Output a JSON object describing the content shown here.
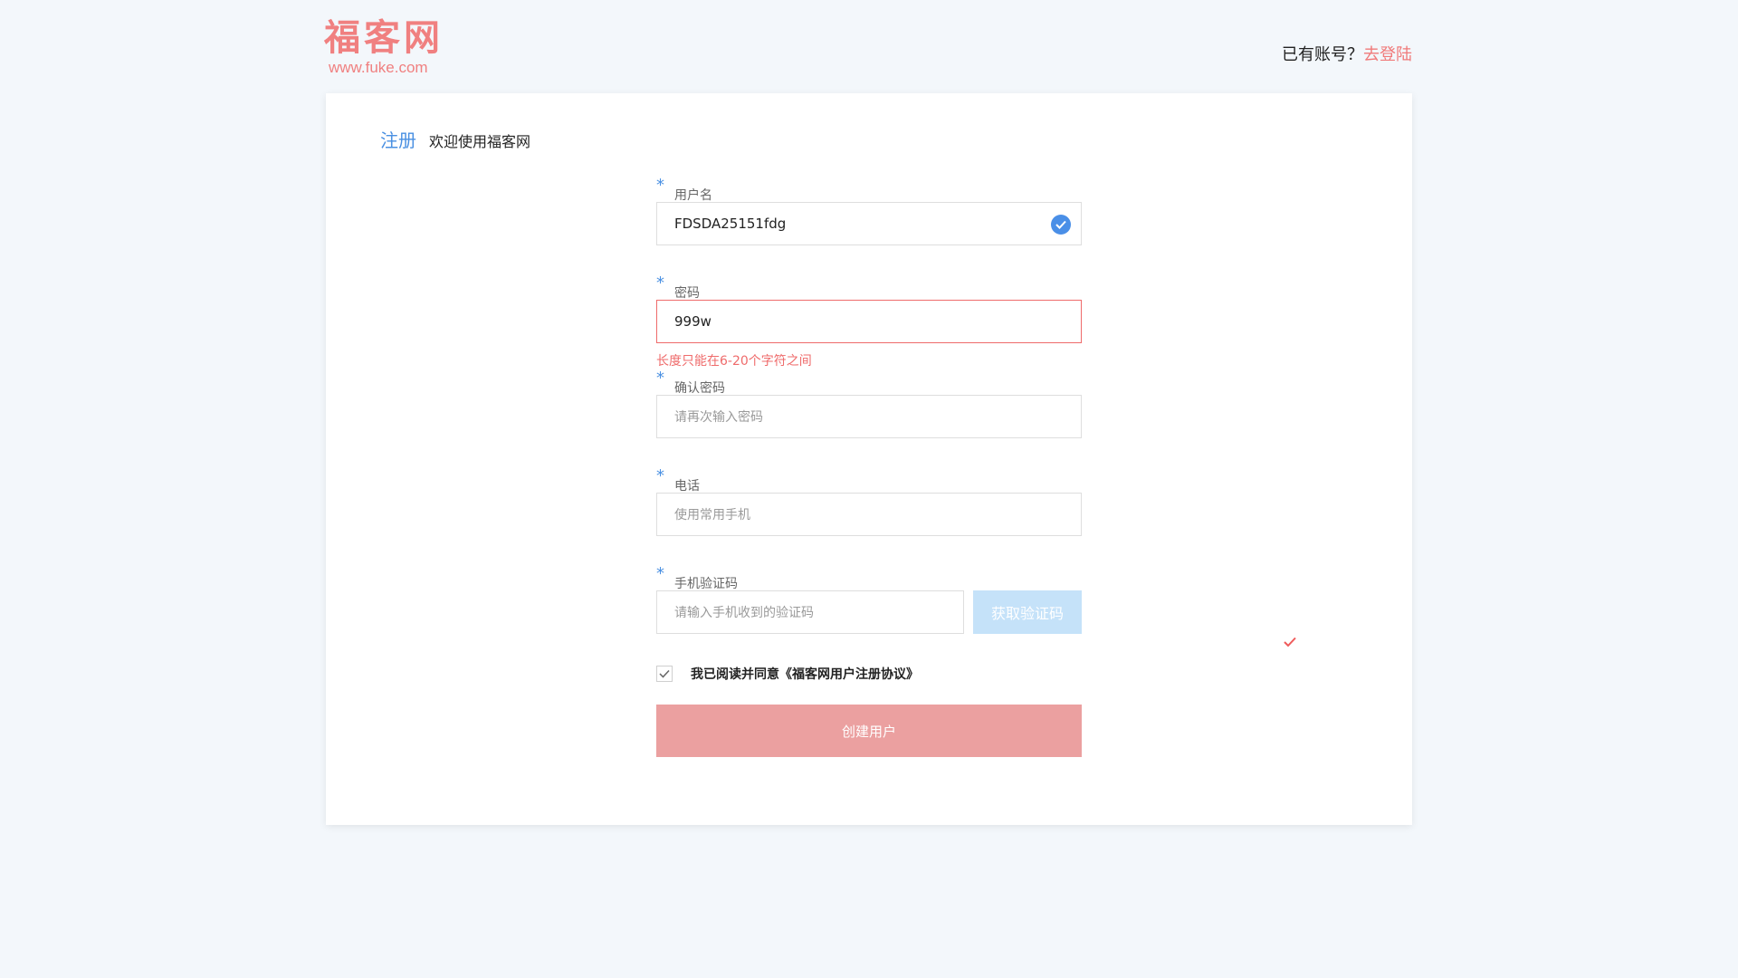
{
  "header": {
    "logo_text": "福客网",
    "logo_url": "www.fuke.com",
    "login_prompt": "已有账号？",
    "login_link": "去登陆"
  },
  "card": {
    "tab": "注册",
    "welcome": "欢迎使用福客网"
  },
  "form": {
    "required_mark": "*",
    "username": {
      "label": "用户名",
      "value": "FDSDA25151fdg"
    },
    "password": {
      "label": "密码",
      "value": "999w",
      "error": "长度只能在6-20个字符之间"
    },
    "confirm_password": {
      "label": "确认密码",
      "placeholder": "请再次输入密码"
    },
    "phone": {
      "label": "电话",
      "placeholder": "使用常用手机"
    },
    "sms_code": {
      "label": "手机验证码",
      "placeholder": "请输入手机收到的验证码",
      "button": "获取验证码"
    },
    "agreement": {
      "text": "我已阅读并同意《福客网用户注册协议》",
      "checked": true
    },
    "submit": "创建用户"
  },
  "colors": {
    "brand": "#f08080",
    "accent_blue": "#4a90e2",
    "error": "#ef6b6b",
    "submit_bg": "#eba0a0",
    "code_button_bg": "#c5e2f9"
  }
}
